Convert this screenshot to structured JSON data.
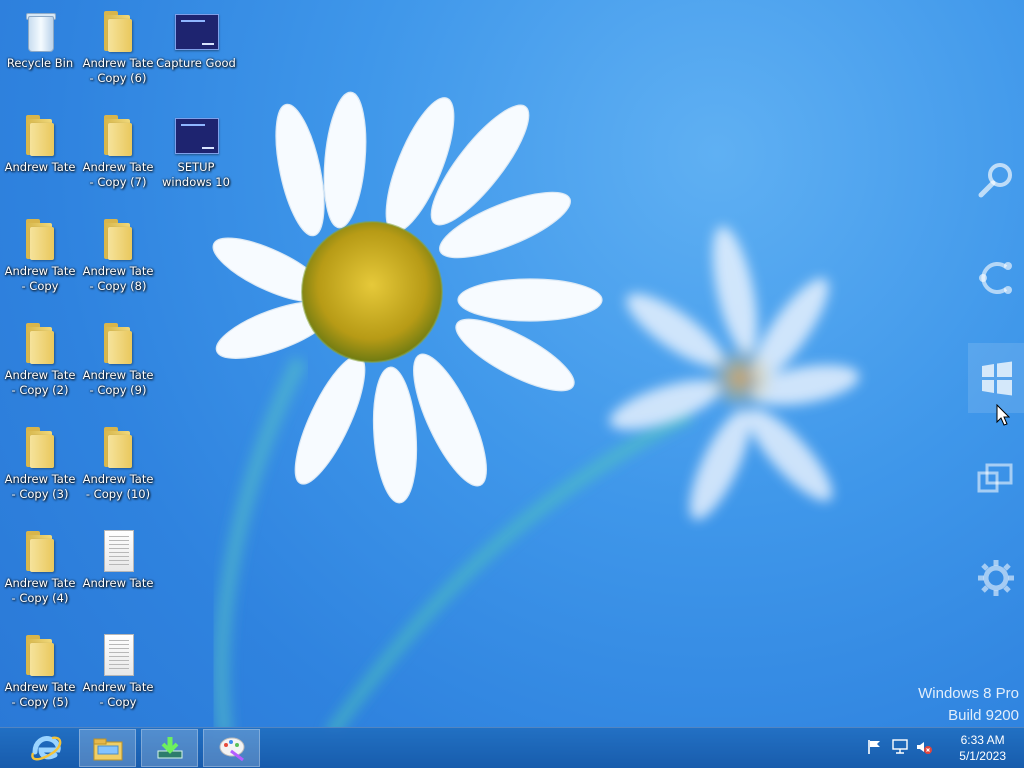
{
  "desktop": {
    "icons": [
      {
        "label": "Recycle Bin",
        "type": "recycle-bin"
      },
      {
        "label": "Andrew Tate\n- Copy (6)",
        "type": "folder"
      },
      {
        "label": "Capture Good",
        "type": "app"
      },
      {
        "label": "Andrew Tate",
        "type": "folder"
      },
      {
        "label": "Andrew Tate\n- Copy (7)",
        "type": "folder"
      },
      {
        "label": "SETUP\nwindows 10",
        "type": "app"
      },
      {
        "label": "Andrew Tate\n- Copy",
        "type": "folder"
      },
      {
        "label": "Andrew Tate\n- Copy (8)",
        "type": "folder"
      },
      {
        "label": "Andrew Tate\n- Copy (2)",
        "type": "folder"
      },
      {
        "label": "Andrew Tate\n- Copy (9)",
        "type": "folder"
      },
      {
        "label": "Andrew Tate\n- Copy (3)",
        "type": "folder"
      },
      {
        "label": "Andrew Tate\n- Copy (10)",
        "type": "folder"
      },
      {
        "label": "Andrew Tate\n- Copy (4)",
        "type": "folder"
      },
      {
        "label": "Andrew Tate",
        "type": "text-document"
      },
      {
        "label": "Andrew Tate\n- Copy (5)",
        "type": "folder"
      },
      {
        "label": "Andrew Tate\n- Copy",
        "type": "text-document"
      }
    ]
  },
  "charms": [
    {
      "name": "search-charm",
      "icon": "search-icon"
    },
    {
      "name": "share-charm",
      "icon": "share-icon"
    },
    {
      "name": "start-charm",
      "icon": "windows-logo-icon"
    },
    {
      "name": "devices-charm",
      "icon": "devices-icon"
    },
    {
      "name": "settings-charm",
      "icon": "gear-icon"
    }
  ],
  "watermark": {
    "line1": "Windows 8 Pro",
    "line2": "Build 9200"
  },
  "taskbar": {
    "buttons": [
      {
        "name": "internet-explorer",
        "icon": "ie-icon"
      },
      {
        "name": "file-explorer",
        "icon": "folder-icon"
      },
      {
        "name": "download-app",
        "icon": "download-icon"
      },
      {
        "name": "paint-app",
        "icon": "paint-icon"
      }
    ],
    "tray": {
      "icons": [
        "flag-icon",
        "network-icon",
        "volume-muted-icon"
      ],
      "time": "6:33 AM",
      "date": "5/1/2023"
    }
  },
  "colors": {
    "wallpaper": "#3f97ea",
    "taskbar": "#216fc2",
    "folder": "#e9c85d"
  }
}
